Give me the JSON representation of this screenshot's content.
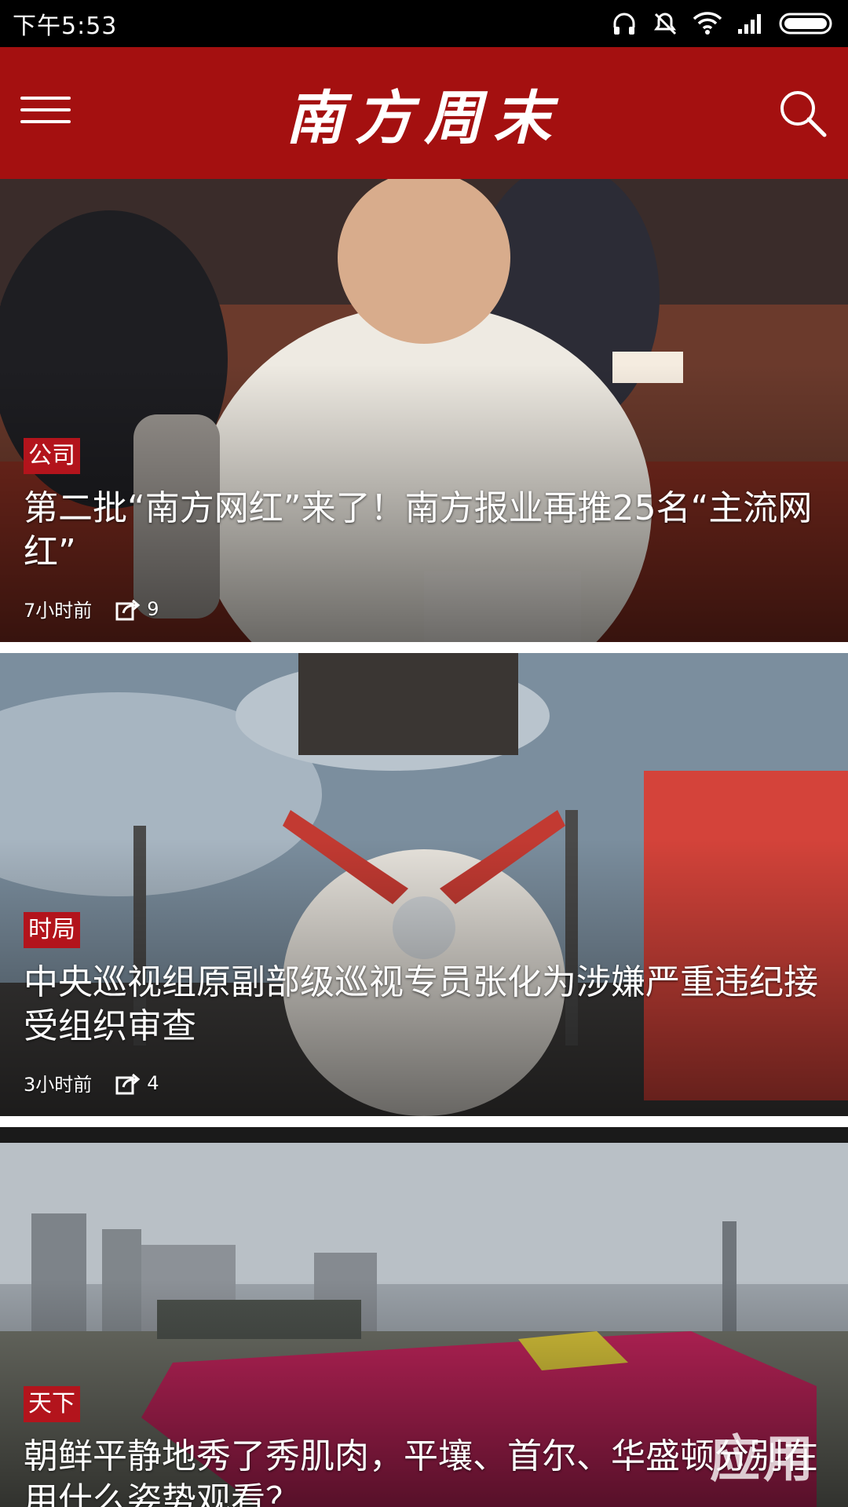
{
  "status_bar": {
    "time": "下午5:53"
  },
  "app_bar": {
    "brand": "南方周末"
  },
  "articles": [
    {
      "tag": "公司",
      "title": "第二批“南方网红”来了！南方报业再推25名“主流网红”",
      "time": "7小时前",
      "shares": "9"
    },
    {
      "tag": "时局",
      "title": "中央巡视组原副部级巡视专员张化为涉嫌严重违纪接受组织审查",
      "time": "3小时前",
      "shares": "4"
    },
    {
      "tag": "天下",
      "title": "朝鲜平静地秀了秀肌肉，平壤、首尔、华盛顿分别在用什么姿势观看？"
    }
  ],
  "watermark": {
    "text": "应用"
  }
}
